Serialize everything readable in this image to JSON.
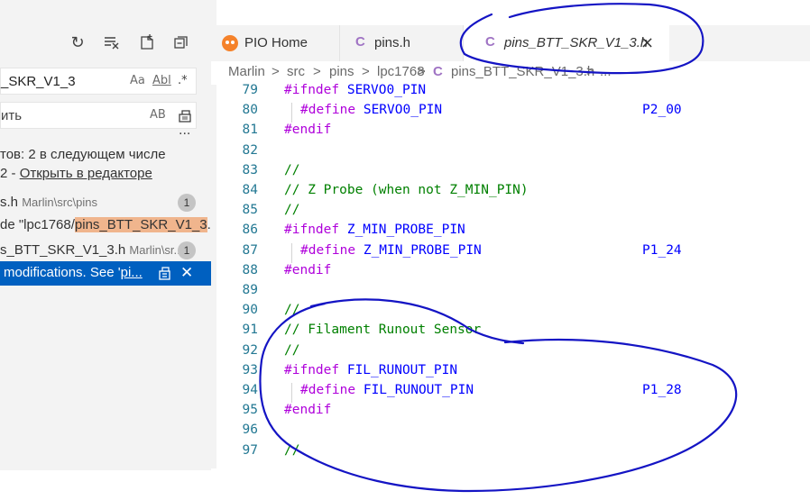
{
  "left_panel": {
    "toolbar_icons": [
      "refresh-icon",
      "clear-results-icon",
      "new-search-editor-icon",
      "collapse-all-icon"
    ],
    "search_value": "_SKR_V1_3",
    "search_options": {
      "case": "Aa",
      "word": "Abl",
      "regex": ".*"
    },
    "replace_value": "ить",
    "replace_option": "AB",
    "more": "...",
    "summary_line1": "тов: 2 в следующем числе",
    "summary_line2_prefix": "2 - ",
    "summary_link": "Открыть в редакторе",
    "results": [
      {
        "file": "s.h",
        "path": "Marlin\\src\\pins",
        "count": "1"
      },
      {
        "match_prefix": "de \"lpc1768/",
        "match_hl": "pins_BTT_SKR_V1_3",
        "match_suffix": "..."
      },
      {
        "file": "s_BTT_SKR_V1_3.h",
        "path": "Marlin\\sr...",
        "count": "1"
      },
      {
        "match_prefix": " modifications. See '",
        "match_hl": "pi..."
      }
    ]
  },
  "tabs": [
    {
      "label": "PIO Home",
      "icon": "platformio-icon"
    },
    {
      "label": "pins.h",
      "icon": "C"
    },
    {
      "label": "pins_BTT_SKR_V1_3.h",
      "icon": "C",
      "active": true,
      "close": "×"
    }
  ],
  "breadcrumb": [
    "Marlin",
    ">",
    "src",
    ">",
    "pins",
    ">",
    "lpc1768",
    ">",
    "C",
    "pins_BTT_SKR_V1_3.h",
    ">",
    "..."
  ],
  "editor": {
    "lines": [
      {
        "n": "79",
        "indent": false,
        "parts": [
          [
            "kw",
            "#ifndef "
          ],
          [
            "id",
            "SERVO0_PIN"
          ]
        ]
      },
      {
        "n": "80",
        "indent": true,
        "parts": [
          [
            "kw",
            "#define "
          ],
          [
            "id",
            "SERVO0_PIN"
          ]
        ],
        "value": "P2_00"
      },
      {
        "n": "81",
        "indent": false,
        "parts": [
          [
            "kw",
            "#endif"
          ]
        ]
      },
      {
        "n": "82",
        "indent": false,
        "parts": []
      },
      {
        "n": "83",
        "indent": false,
        "parts": [
          [
            "cm",
            "//"
          ]
        ]
      },
      {
        "n": "84",
        "indent": false,
        "parts": [
          [
            "cm",
            "// Z Probe (when not Z_MIN_PIN)"
          ]
        ]
      },
      {
        "n": "85",
        "indent": false,
        "parts": [
          [
            "cm",
            "//"
          ]
        ]
      },
      {
        "n": "86",
        "indent": false,
        "parts": [
          [
            "kw",
            "#ifndef "
          ],
          [
            "id",
            "Z_MIN_PROBE_PIN"
          ]
        ]
      },
      {
        "n": "87",
        "indent": true,
        "parts": [
          [
            "kw",
            "#define "
          ],
          [
            "id",
            "Z_MIN_PROBE_PIN"
          ]
        ],
        "value": "P1_24"
      },
      {
        "n": "88",
        "indent": false,
        "parts": [
          [
            "kw",
            "#endif"
          ]
        ]
      },
      {
        "n": "89",
        "indent": false,
        "parts": []
      },
      {
        "n": "90",
        "indent": false,
        "parts": [
          [
            "cm",
            "//"
          ]
        ]
      },
      {
        "n": "91",
        "indent": false,
        "parts": [
          [
            "cm",
            "// Filament Runout Sensor"
          ]
        ]
      },
      {
        "n": "92",
        "indent": false,
        "parts": [
          [
            "cm",
            "//"
          ]
        ]
      },
      {
        "n": "93",
        "indent": false,
        "parts": [
          [
            "kw",
            "#ifndef "
          ],
          [
            "id",
            "FIL_RUNOUT_PIN"
          ]
        ]
      },
      {
        "n": "94",
        "indent": true,
        "parts": [
          [
            "kw",
            "#define "
          ],
          [
            "id",
            "FIL_RUNOUT_PIN"
          ]
        ],
        "value": "P1_28"
      },
      {
        "n": "95",
        "indent": false,
        "parts": [
          [
            "kw",
            "#endif"
          ]
        ]
      },
      {
        "n": "96",
        "indent": false,
        "parts": []
      },
      {
        "n": "97",
        "indent": false,
        "parts": [
          [
            "cm",
            "//"
          ]
        ]
      }
    ]
  },
  "colors": {
    "ink": "#1010c8",
    "selection": "#0060c0",
    "keyword": "#af00db",
    "comment": "#008000",
    "identifier": "#0000ff",
    "match_highlight": "#f0b58d"
  }
}
